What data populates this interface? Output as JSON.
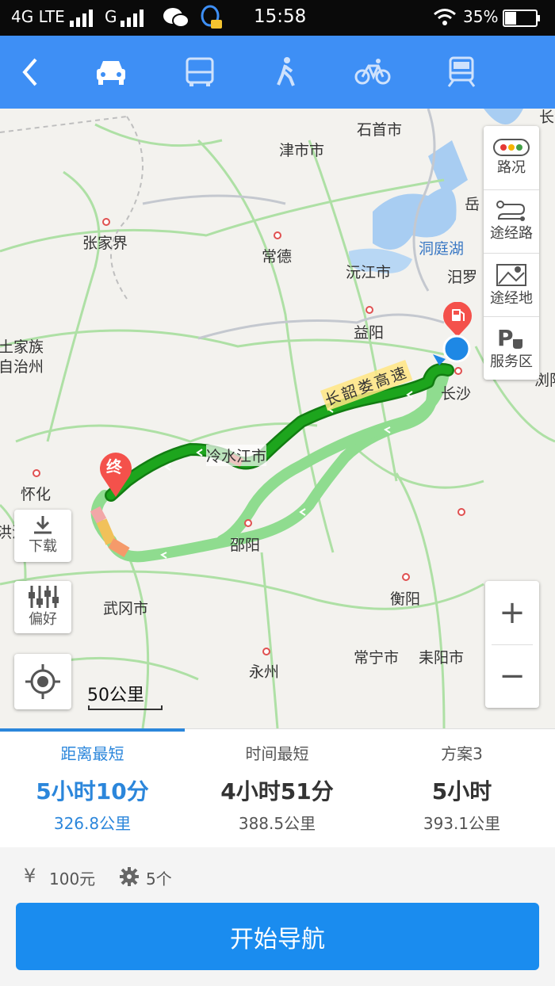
{
  "status_bar": {
    "network": "4G LTE",
    "network2": "G",
    "time": "15:58",
    "battery": "35%"
  },
  "map": {
    "cities": [
      "石首市",
      "津市市",
      "岳",
      "张家界",
      "常德",
      "洞庭湖",
      "沅江市",
      "汨罗",
      "土家族",
      "自治州",
      "益阳",
      "浏阳",
      "长沙",
      "冷水江市",
      "怀化",
      "洪江",
      "邵阳",
      "武冈市",
      "衡阳",
      "常宁市",
      "耒阳市",
      "永州",
      "长江"
    ],
    "highway_label": "长韶娄高速",
    "end_marker": "终",
    "scale_label": "50公里"
  },
  "right_panel": {
    "traffic": "路况",
    "waypoint_route": "途经路",
    "waypoint_place": "途经地",
    "service_area": "服务区"
  },
  "left_controls": {
    "download": "下载",
    "preference": "偏好"
  },
  "zoom": {
    "plus": "+",
    "minus": "−"
  },
  "routes": [
    {
      "name": "距离最短",
      "time": "5小时10分",
      "distance": "326.8公里"
    },
    {
      "name": "时间最短",
      "time": "4小时51分",
      "distance": "388.5公里"
    },
    {
      "name": "方案3",
      "time": "5小时",
      "distance": "393.1公里"
    }
  ],
  "info": {
    "toll": "100元",
    "lights": "5个"
  },
  "start_nav": "开始导航",
  "colors": {
    "accent": "#3e8ff5",
    "route_green": "#1da51d",
    "route_alt": "#8fdc8f",
    "nav_button": "#1a8cef"
  }
}
